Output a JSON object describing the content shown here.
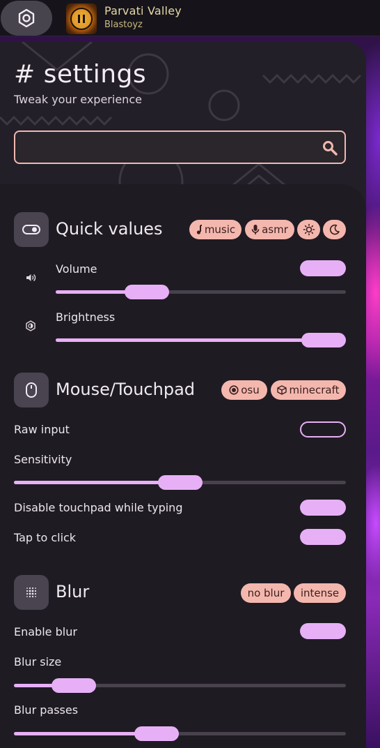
{
  "topbar": {
    "track_title": "Parvati Valley",
    "track_artist": "Blastoyz"
  },
  "header": {
    "title": "# settings",
    "subtitle": "Tweak your experience",
    "search_value": ""
  },
  "quick_values": {
    "title": "Quick values",
    "chips": {
      "music": "music",
      "asmr": "asmr"
    },
    "volume_label": "Volume",
    "volume_value": 0.28,
    "brightness_label": "Brightness",
    "brightness_value": 1.0,
    "volume_toggle_on": true
  },
  "mouse": {
    "title": "Mouse/Touchpad",
    "chips": {
      "osu": "osu",
      "minecraft": "minecraft"
    },
    "raw_input_label": "Raw input",
    "raw_input_on": false,
    "sensitivity_label": "Sensitivity",
    "sensitivity_value": 0.5,
    "disable_touchpad_label": "Disable touchpad while typing",
    "disable_touchpad_on": true,
    "tap_to_click_label": "Tap to click",
    "tap_to_click_on": true
  },
  "blur": {
    "title": "Blur",
    "chips": {
      "no_blur": "no blur",
      "intense": "intense"
    },
    "enable_label": "Enable blur",
    "enable_on": true,
    "size_label": "Blur size",
    "size_value": 0.13,
    "passes_label": "Blur passes",
    "passes_value": 0.42
  },
  "colors": {
    "accent": "#e7b0f6",
    "chip": "#f4b7ae",
    "panel": "#231f28"
  }
}
